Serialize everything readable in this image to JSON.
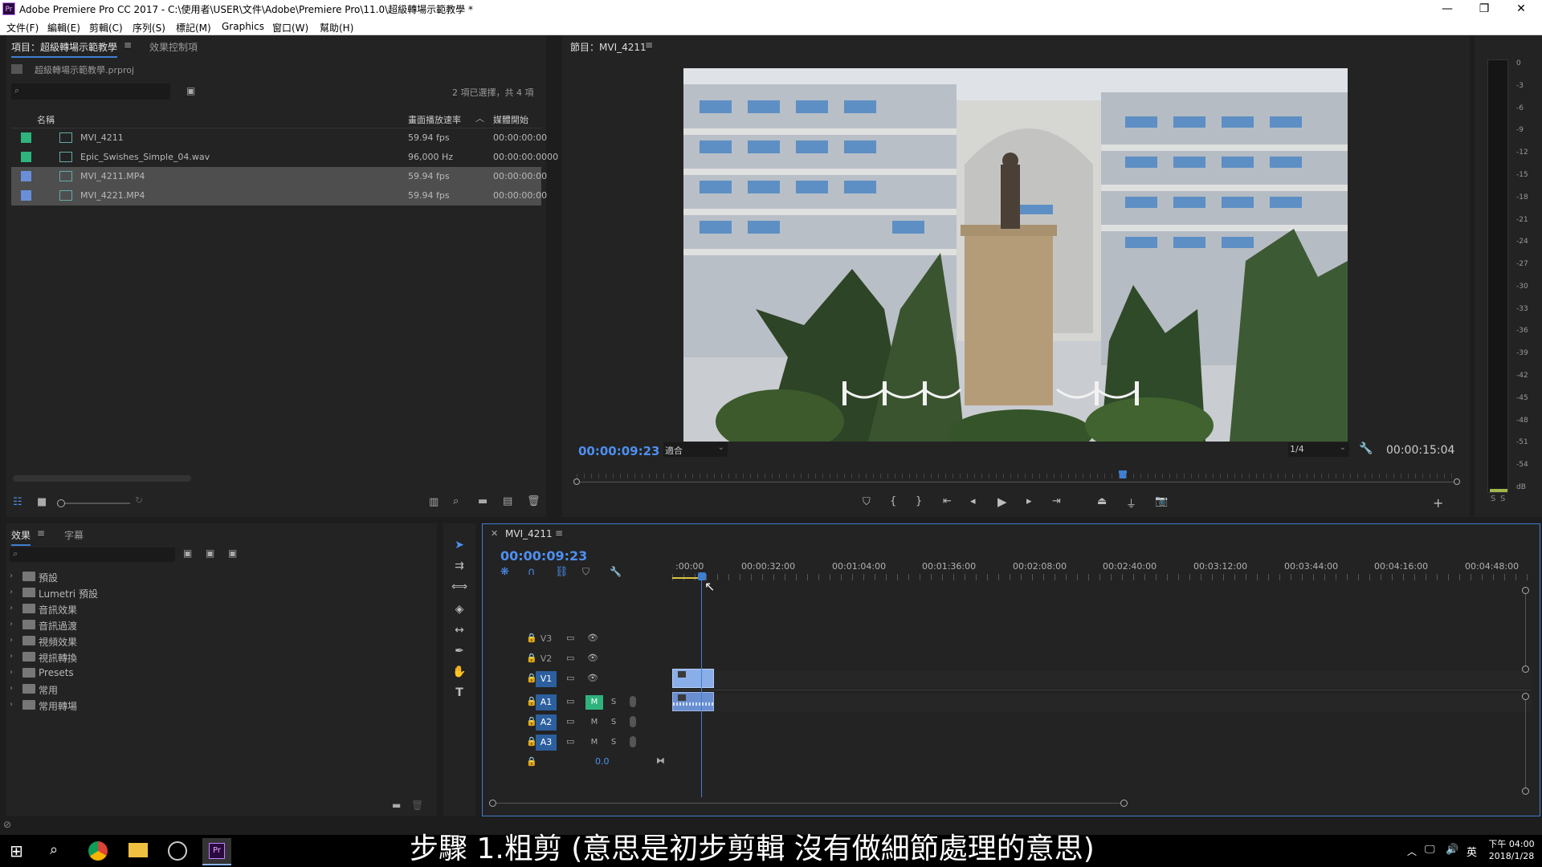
{
  "window": {
    "title": "Adobe Premiere Pro CC 2017 - C:\\使用者\\USER\\文件\\Adobe\\Premiere Pro\\11.0\\超級轉場示範教學 *",
    "app_icon": "Pr"
  },
  "menu": [
    "文件(F)",
    "編輯(E)",
    "剪輯(C)",
    "序列(S)",
    "標記(M)",
    "Graphics",
    "窗口(W)",
    "幫助(H)"
  ],
  "project_panel": {
    "tabs": [
      "項目：超級轉場示範教學",
      "效果控制項"
    ],
    "file": "超級轉場示範教學.prproj",
    "selection_info": "2 項已選擇，共 4 項",
    "columns": [
      "名稱",
      "畫面播放速率",
      "媒體開始"
    ],
    "items": [
      {
        "name": "MVI_4211",
        "rate": "59.94 fps",
        "start": "00:00:00:00",
        "color": "#2fb37d",
        "selected": false
      },
      {
        "name": "Epic_Swishes_Simple_04.wav",
        "rate": "96,000 Hz",
        "start": "00:00:00:0000",
        "color": "#2fb37d",
        "selected": false
      },
      {
        "name": "MVI_4211.MP4",
        "rate": "59.94 fps",
        "start": "00:00:00:00",
        "color": "#6a8fd8",
        "selected": true
      },
      {
        "name": "MVI_4221.MP4",
        "rate": "59.94 fps",
        "start": "00:00:00:00",
        "color": "#6a8fd8",
        "selected": true
      }
    ]
  },
  "program_monitor": {
    "title": "節目：MVI_4211",
    "timecode": "00:00:09:23",
    "fit": "適合",
    "resolution": "1/4",
    "duration": "00:00:15:04",
    "playhead_fraction": 0.62
  },
  "audio_meter": {
    "ticks": [
      "0",
      "-3",
      "-6",
      "-9",
      "-12",
      "-15",
      "-18",
      "-21",
      "-24",
      "-27",
      "-30",
      "-33",
      "-36",
      "-39",
      "-42",
      "-45",
      "-48",
      "-51",
      "-54",
      "dB"
    ],
    "solo": [
      "S",
      "S"
    ]
  },
  "effects_panel": {
    "tabs": [
      "效果",
      "字幕"
    ],
    "folders": [
      "預設",
      "Lumetri 預設",
      "音訊效果",
      "音訊過渡",
      "視頻效果",
      "視訊轉換",
      "Presets",
      "常用",
      "常用轉場"
    ]
  },
  "timeline": {
    "sequence": "MVI_4211",
    "timecode": "00:00:09:23",
    "ruler": [
      ":00:00",
      "00:00:32:00",
      "00:01:04:00",
      "00:01:36:00",
      "00:02:08:00",
      "00:02:40:00",
      "00:03:12:00",
      "00:03:44:00",
      "00:04:16:00",
      "00:04:48:00"
    ],
    "video_tracks": [
      "V3",
      "V2",
      "V1"
    ],
    "audio_tracks": [
      "A1",
      "A2",
      "A3"
    ],
    "m_label": "M",
    "s_label": "S",
    "master_value": "0.0"
  },
  "subtitle": "步驟 1.粗剪 (意思是初步剪輯 沒有做細節處理的意思)",
  "taskbar": {
    "time": "下午 04:00",
    "date": "2018/1/28",
    "ime": "英"
  }
}
